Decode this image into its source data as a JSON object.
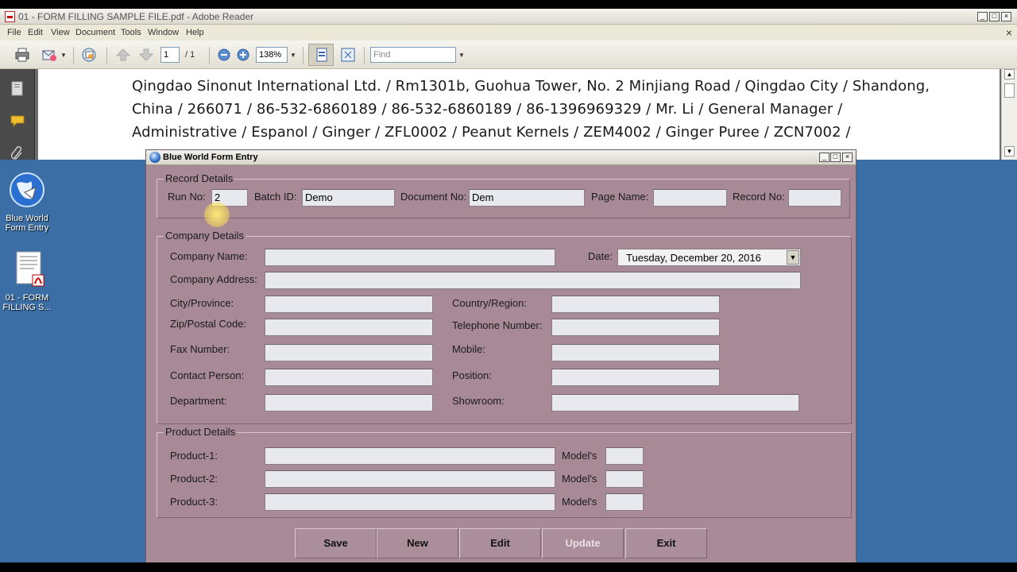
{
  "reader": {
    "title": "01 - FORM FILLING SAMPLE FILE.pdf - Adobe Reader",
    "window_buttons": [
      "_",
      "□",
      "×"
    ],
    "menu": [
      "File",
      "Edit",
      "View",
      "Document",
      "Tools",
      "Window",
      "Help"
    ],
    "doc_close": "×",
    "toolbar": {
      "page_current": "1",
      "page_total": "/ 1",
      "zoom": "138%",
      "find_placeholder": "Find"
    },
    "document_lines": [
      "Qingdao Sinonut International Ltd.  /  Rm1301b, Guohua Tower, No. 2 Minjiang Road  /  Qingdao City   /  Shandong,",
      "China  /  266071  /  86-532-6860189  /  86-532-6860189  /  86-1396969329  /  Mr. Li  /  General Manager  /",
      "Administrative  /  Espanol  /  Ginger  /  ZFL0002  /  Peanut Kernels  /  ZEM4002  /  Ginger Puree  /  ZCN7002  /"
    ]
  },
  "desktop": {
    "icons": [
      {
        "label_line1": "Blue World",
        "label_line2": "Form Entry",
        "icon": "globe-icon"
      },
      {
        "label_line1": "01 - FORM",
        "label_line2": "FILLING S...",
        "icon": "pdf-file-icon"
      }
    ]
  },
  "form": {
    "title": "Blue World Form Entry",
    "window_buttons": [
      "_",
      "□",
      "×"
    ],
    "record": {
      "title": "Record Details",
      "run_no_label": "Run No:",
      "run_no_value": "2",
      "batch_id_label": "Batch ID:",
      "batch_id_value": "Demo",
      "document_no_label": "Document No:",
      "document_no_value": "Dem",
      "page_name_label": "Page Name:",
      "page_name_value": "",
      "record_no_label": "Record No:",
      "record_no_value": ""
    },
    "company": {
      "title": "Company Details",
      "company_name_label": "Company Name:",
      "date_label": "Date:",
      "date_weekday": "Tuesday",
      "date_rest": ",  December  20, 2016",
      "company_address_label": "Company Address:",
      "city_label": "City/Province:",
      "country_label": "Country/Region:",
      "zip_label": "Zip/Postal Code:",
      "telephone_label": "Telephone Number:",
      "fax_label": "Fax Number:",
      "mobile_label": "Mobile:",
      "contact_label": "Contact Person:",
      "position_label": "Position:",
      "department_label": "Department:",
      "showroom_label": "Showroom:"
    },
    "product": {
      "title": "Product Details",
      "rows": [
        {
          "label": "Product-1:",
          "model_label": "Model's"
        },
        {
          "label": "Product-2:",
          "model_label": "Model's"
        },
        {
          "label": "Product-3:",
          "model_label": "Model's"
        }
      ]
    },
    "buttons": {
      "save": "Save",
      "new": "New",
      "edit": "Edit",
      "update": "Update",
      "exit": "Exit"
    }
  }
}
